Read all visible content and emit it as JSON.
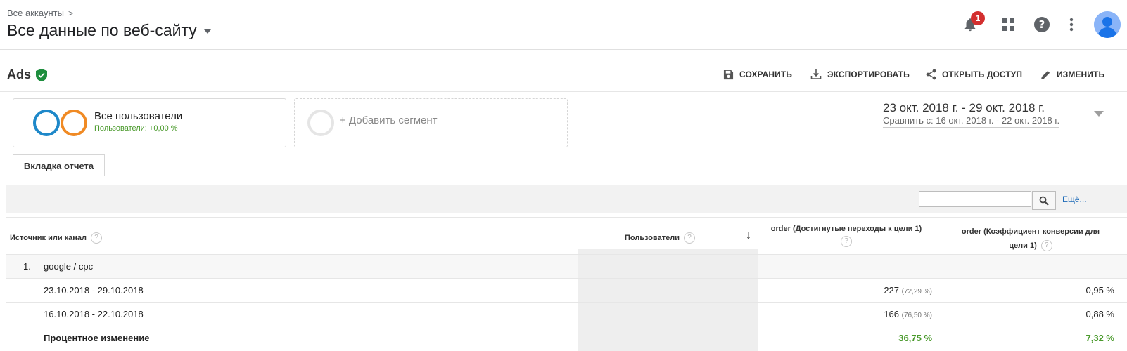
{
  "header": {
    "breadcrumb": "Все аккаунты",
    "breadcrumb_chevron": ">",
    "view_title": "Все данные по веб-сайту",
    "notification_count": "1",
    "icons": [
      "bell-icon",
      "apps-grid-icon",
      "help-icon",
      "more-vert-icon",
      "avatar-icon"
    ]
  },
  "report": {
    "title": "Ads",
    "toolbar": {
      "save": "СОХРАНИТЬ",
      "export": "ЭКСПОРТИРОВАТЬ",
      "share": "ОТКРЫТЬ ДОСТУП",
      "edit": "ИЗМЕНИТЬ"
    }
  },
  "segments": {
    "active_name": "Все пользователи",
    "active_sub": "Пользователи: +0,00 %",
    "add_label": "+ Добавить сегмент",
    "colors": {
      "blue": "#1e88c9",
      "orange": "#f08a24"
    }
  },
  "date_range": {
    "main": "23 окт. 2018 г. - 29 окт. 2018 г.",
    "compare": "Сравнить с: 16 окт. 2018 г. - 22 окт. 2018 г."
  },
  "tab_label": "Вкладка отчета",
  "search": {
    "more_link": "Ещё..."
  },
  "table": {
    "col_source": "Источник или канал",
    "col_users": "Пользователи",
    "col_goal_completions": "order (Достигнутые переходы к цели 1)",
    "col_conversion_l1": "order (Коэффициент конверсии для",
    "col_conversion_l2": "цели 1)",
    "qmark": "?",
    "sort_arrow": "↓",
    "rows": {
      "group_index": "1.",
      "group_name": "google / cpc",
      "r1_period": "23.10.2018 - 29.10.2018",
      "r1_goals": "227",
      "r1_goals_pct": "(72,29 %)",
      "r1_conv": "0,95 %",
      "r2_period": "16.10.2018 - 22.10.2018",
      "r2_goals": "166",
      "r2_goals_pct": "(76,50 %)",
      "r2_conv": "0,88 %",
      "r3_label": "Процентное изменение",
      "r3_goals": "36,75 %",
      "r3_conv": "7,32 %"
    }
  }
}
